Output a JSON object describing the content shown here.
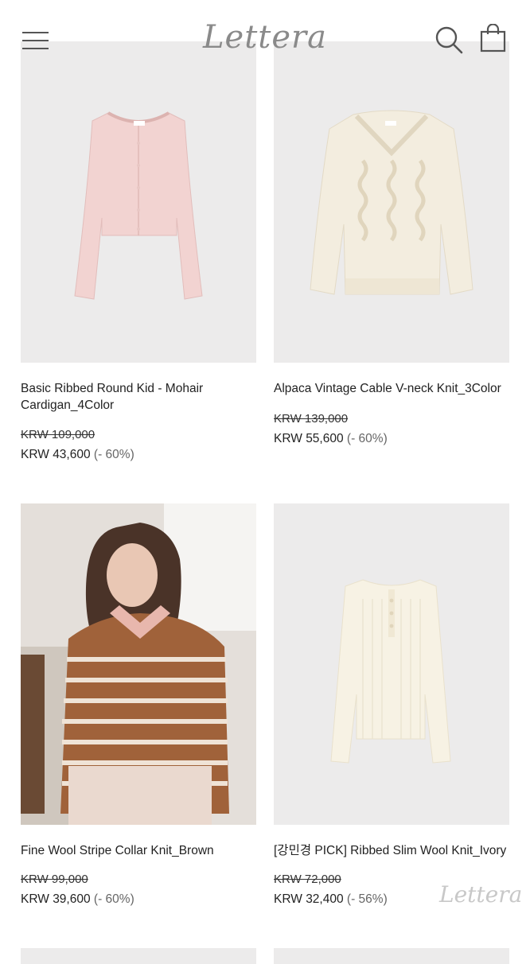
{
  "header": {
    "logo": "Lettera",
    "menu_icon": "hamburger-menu-icon",
    "search_icon": "search-icon",
    "bag_icon": "shopping-bag-icon"
  },
  "products": [
    {
      "name": "Basic Ribbed Round Kid - Mohair Cardigan_4Color",
      "original_price": "KRW 109,000",
      "sale_price": "KRW 43,600",
      "discount": "(- 60%)",
      "image": "pink-cardigan"
    },
    {
      "name": "Alpaca Vintage Cable V-neck Knit_3Color",
      "original_price": "KRW 139,000",
      "sale_price": "KRW 55,600",
      "discount": "(- 60%)",
      "image": "cream-cable-knit"
    },
    {
      "name": "Fine Wool Stripe Collar Knit_Brown",
      "original_price": "KRW 99,000",
      "sale_price": "KRW 39,600",
      "discount": "(- 60%)",
      "image": "model-brown-stripe-knit"
    },
    {
      "name": "[강민경 PICK] Ribbed Slim Wool Knit_Ivory",
      "original_price": "KRW 72,000",
      "sale_price": "KRW 32,400",
      "discount": "(- 56%)",
      "image": "ivory-ribbed-knit"
    }
  ],
  "watermark": "Lettera",
  "colors": {
    "image_bg": "#ecebeb",
    "pink_cardigan": "#f2d3d1",
    "cream_knit": "#f3eddf",
    "brown_stripe": "#a0623a",
    "ivory": "#f7f2e4"
  }
}
